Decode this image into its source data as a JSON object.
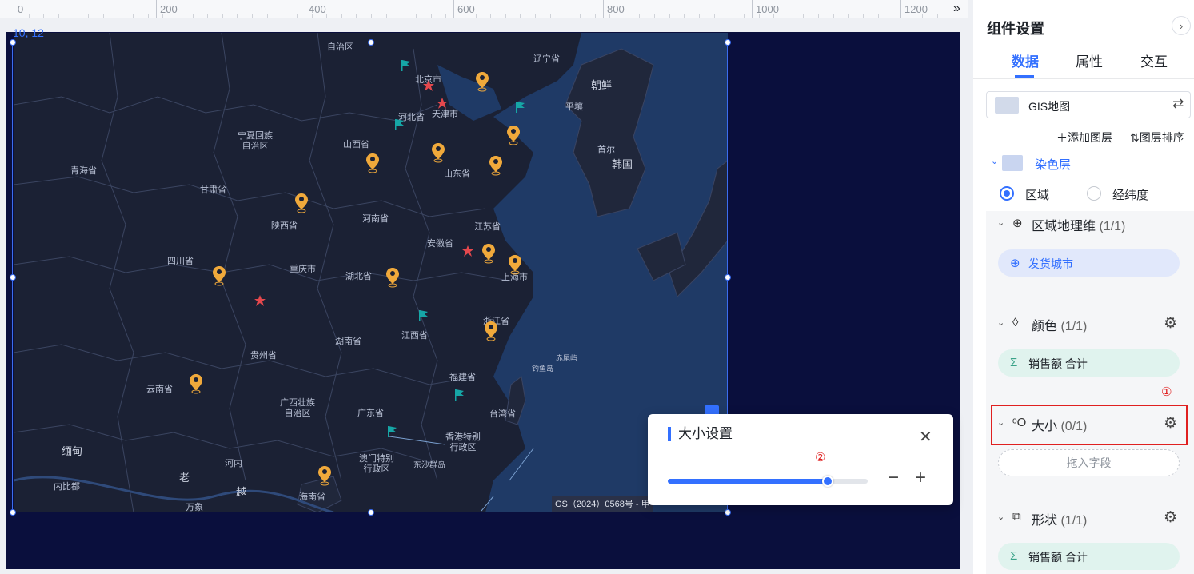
{
  "ruler": {
    "labels": [
      "0",
      "200",
      "400",
      "600",
      "800",
      "1000",
      "1200"
    ],
    "expand_icon": "double-chevron-right-icon"
  },
  "canvas": {
    "coords": "10, 12",
    "background_color": "#0a0f3d",
    "map": {
      "country_labels": [
        "朝鲜",
        "韩国",
        "缅甸",
        "老",
        "越"
      ],
      "province_labels": [
        "辽宁省",
        "北京市",
        "天津市",
        "河北省",
        "山西省",
        "宁夏回族自治区",
        "青海省",
        "甘肃省",
        "山东省",
        "河南省",
        "陕西省",
        "江苏省",
        "安徽省",
        "上海市",
        "四川省",
        "重庆市",
        "湖北省",
        "浙江省",
        "江西省",
        "湖南省",
        "贵州省",
        "福建省",
        "台湾省",
        "云南省",
        "广西壮族自治区",
        "广东省",
        "香港特别行政区",
        "澳门特别行政区",
        "海南省"
      ],
      "minor_labels": [
        "自治区",
        "平壤",
        "首尔",
        "赤尾屿",
        "钓鱼岛",
        "东沙群岛",
        "河内",
        "内比都",
        "万象"
      ],
      "copyright": "GS（2024）0568号 - 甲",
      "marker_colors": {
        "pin": "#f0a93b",
        "star": "#e5484d",
        "flag": "#16a6a6"
      }
    }
  },
  "size_popup": {
    "title": "大小设置",
    "close_icon": "close-icon",
    "slider_value_percent": 80,
    "minus_icon": "minus-icon",
    "plus_icon": "plus-icon",
    "step_marker": "②"
  },
  "panel": {
    "title": "组件设置",
    "tabs": [
      "数据",
      "属性",
      "交互"
    ],
    "active_tab": "数据",
    "dataset": {
      "name": "GIS地图",
      "swap_icon": "swap-icon"
    },
    "add_layer": "添加图层",
    "sort_layers": "图层排序",
    "layer": {
      "name": "染色层"
    },
    "radio": {
      "options": [
        "区域",
        "经纬度"
      ],
      "selected": "区域"
    },
    "sections": {
      "region": {
        "title": "区域地理维",
        "count": "(1/1)",
        "field": "发货城市"
      },
      "color": {
        "title": "颜色",
        "count": "(1/1)",
        "field": "销售额",
        "agg": "合计"
      },
      "size": {
        "title": "大小",
        "count": "(0/1)",
        "placeholder": "拖入字段"
      },
      "shape": {
        "title": "形状",
        "count": "(1/1)",
        "field": "销售额",
        "agg": "合计"
      }
    },
    "step_marker": "①"
  }
}
